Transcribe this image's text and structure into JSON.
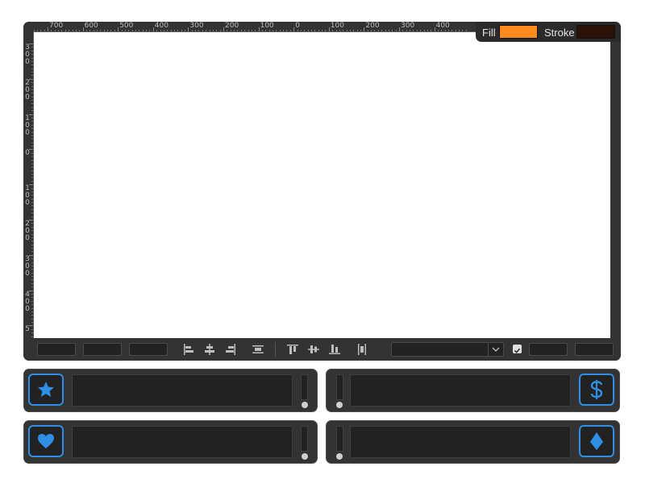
{
  "ruler": {
    "top_labels": [
      "700",
      "600",
      "500",
      "400",
      "300",
      "200",
      "100",
      "0",
      "100",
      "200",
      "300",
      "400"
    ],
    "left_labels": [
      "300",
      "200",
      "100",
      "0",
      "100",
      "200",
      "300",
      "400",
      "5"
    ]
  },
  "colors": {
    "fill_label": "Fill",
    "stroke_label": "Stroke",
    "fill": "#ff8a1f",
    "stroke": "#2b1206",
    "accent": "#2e8fe6"
  },
  "toolbar": {
    "fields_left": [
      "",
      "",
      ""
    ],
    "align_icons": [
      "align-left-icon",
      "align-center-h-icon",
      "align-right-icon",
      "distribute-h-icon",
      "align-top-icon",
      "align-middle-v-icon",
      "align-bottom-icon",
      "distribute-v-icon"
    ],
    "select_value": "",
    "checkbox_checked": true,
    "fields_right": [
      "",
      ""
    ]
  },
  "cards": [
    {
      "icon": "star-icon",
      "text": ""
    },
    {
      "icon": "dollar-icon",
      "text": ""
    },
    {
      "icon": "heart-icon",
      "text": ""
    },
    {
      "icon": "diamond-icon",
      "text": ""
    }
  ]
}
